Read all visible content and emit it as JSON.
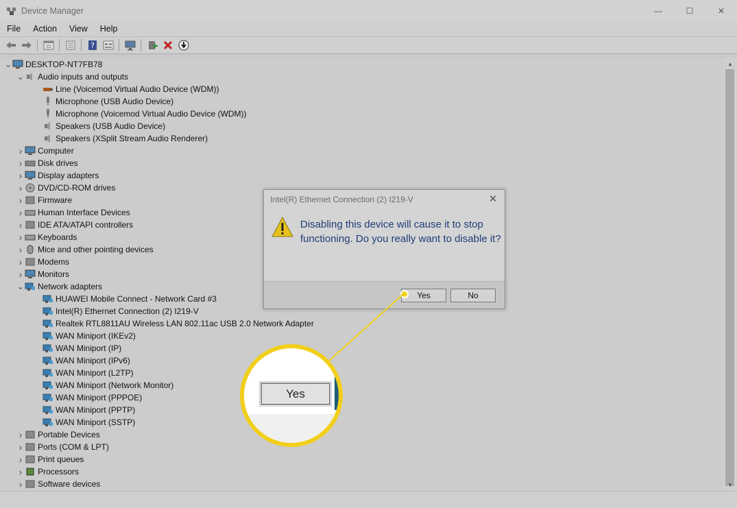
{
  "window": {
    "title": "Device Manager",
    "controls": {
      "minimize": "—",
      "maximize": "☐",
      "close": "✕"
    }
  },
  "menu": [
    "File",
    "Action",
    "View",
    "Help"
  ],
  "toolbar": {
    "buttons": [
      "back-icon",
      "forward-icon",
      "properties-icon",
      "show-hidden-icon",
      "help-icon",
      "resources-icon",
      "monitor-icon",
      "update-driver-icon",
      "uninstall-icon",
      "download-icon"
    ]
  },
  "tree": {
    "root": "DESKTOP-NT7FB78",
    "audio": {
      "label": "Audio inputs and outputs",
      "children": [
        "Line (Voicemod Virtual Audio Device (WDM))",
        "Microphone (USB Audio Device)",
        "Microphone (Voicemod Virtual Audio Device (WDM))",
        "Speakers (USB Audio Device)",
        "Speakers (XSplit  Stream  Audio  Renderer)"
      ]
    },
    "mid_categories": [
      "Computer",
      "Disk drives",
      "Display adapters",
      "DVD/CD-ROM drives",
      "Firmware",
      "Human Interface Devices",
      "IDE ATA/ATAPI controllers",
      "Keyboards",
      "Mice and other pointing devices",
      "Modems",
      "Monitors"
    ],
    "network": {
      "label": "Network adapters",
      "children": [
        "HUAWEI Mobile Connect - Network Card #3",
        "Intel(R) Ethernet Connection (2) I219-V",
        "Realtek RTL8811AU Wireless LAN 802.11ac USB 2.0 Network Adapter",
        "WAN Miniport (IKEv2)",
        "WAN Miniport (IP)",
        "WAN Miniport (IPv6)",
        "WAN Miniport (L2TP)",
        "WAN Miniport (Network Monitor)",
        "WAN Miniport (PPPOE)",
        "WAN Miniport (PPTP)",
        "WAN Miniport (SSTP)"
      ]
    },
    "bottom_categories": [
      "Portable Devices",
      "Ports (COM & LPT)",
      "Print queues",
      "Processors",
      "Software devices"
    ]
  },
  "dialog": {
    "title": "Intel(R) Ethernet Connection (2) I219-V",
    "message": "Disabling this device will cause it to stop functioning. Do you really want to disable it?",
    "yes_label": "Yes",
    "no_label": "No",
    "close": "✕"
  },
  "callout": {
    "label": "Yes",
    "accent": "#f2cf1b"
  }
}
